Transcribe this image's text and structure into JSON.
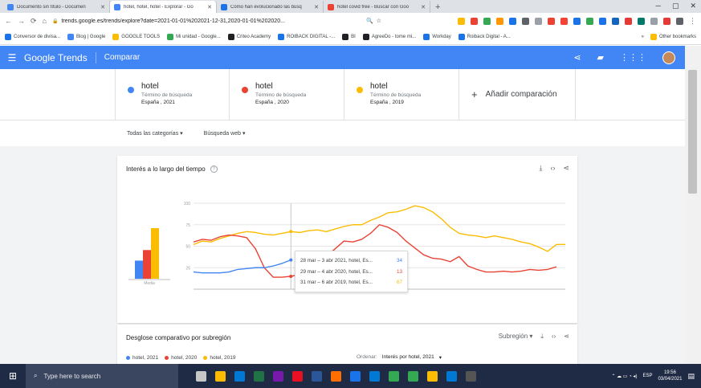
{
  "browser": {
    "tabs": [
      {
        "title": "Documento sin título - Documen",
        "color": "#4285f4"
      },
      {
        "title": "hotel, hotel, hotel - Explorar - Go",
        "color": "#4285f4",
        "active": true
      },
      {
        "title": "Cómo han evolucionado las búsq",
        "color": "#1a73e8"
      },
      {
        "title": "hotel covid free - Buscar con Goo",
        "color": "#ea4335"
      }
    ],
    "tab_close": "✕",
    "new_tab": "+",
    "window_controls": [
      "─",
      "▢",
      "✕"
    ],
    "address": "trends.google.es/trends/explore?date=2021-01-01%202021-12-31,2020-01-01%202020...",
    "bookmarks": [
      {
        "label": "Conversor de divisa...",
        "color": "#1a73e8"
      },
      {
        "label": "Blog | Google",
        "color": "#4285f4"
      },
      {
        "label": "GOOGLE TOOLS",
        "color": "#fbbc04"
      },
      {
        "label": "Mi unidad - Google...",
        "color": "#34a853"
      },
      {
        "label": "Criteo Academy",
        "color": "#202124"
      },
      {
        "label": "ROIBACK DIGITAL -...",
        "color": "#1a73e8"
      },
      {
        "label": "BI",
        "color": "#202124"
      },
      {
        "label": "AgreeDo - tome mi...",
        "color": "#202124"
      },
      {
        "label": "Workday",
        "color": "#1a73e8"
      },
      {
        "label": "Roiback Digital - A...",
        "color": "#1a73e8"
      }
    ],
    "bookmarks_more": "»",
    "other_bookmarks": "Other bookmarks"
  },
  "header": {
    "logo": "Google Trends",
    "section": "Comparar",
    "color": "#4285f4"
  },
  "terms": [
    {
      "name": "hotel",
      "type": "Término de búsqueda",
      "geo": "España , 2021",
      "color": "#4285f4"
    },
    {
      "name": "hotel",
      "type": "Término de búsqueda",
      "geo": "España , 2020",
      "color": "#ea4335"
    },
    {
      "name": "hotel",
      "type": "Término de búsqueda",
      "geo": "España , 2019",
      "color": "#fbbc04"
    }
  ],
  "add_comparison": "Añadir comparación",
  "filters": {
    "category": "Todas las categorías",
    "search_type": "Búsqueda web"
  },
  "interest_card": {
    "title": "Interés a lo largo del tiempo",
    "average_label": "Media",
    "tooltip": [
      {
        "label": "28 mar – 3 abr 2021, hotel, Es...",
        "value": "34",
        "color": "#4285f4"
      },
      {
        "label": "29 mar – 4 abr 2020, hotel, Es...",
        "value": "13",
        "color": "#ea4335"
      },
      {
        "label": "31 mar – 6 abr 2019, hotel, Es...",
        "value": "67",
        "color": "#fbbc04"
      }
    ]
  },
  "chart_data": {
    "type": "line",
    "title": "Interés a lo largo del tiempo",
    "xlabel": "",
    "ylabel": "",
    "ylim": [
      0,
      100
    ],
    "yticks": [
      25,
      50,
      75,
      100
    ],
    "series": [
      {
        "name": "hotel, 2021",
        "color": "#4285f4",
        "values": [
          20,
          19,
          19,
          19,
          20,
          23,
          24,
          25,
          25,
          27,
          30,
          34
        ]
      },
      {
        "name": "hotel, 2020",
        "color": "#ea4335",
        "values": [
          55,
          58,
          57,
          61,
          63,
          62,
          60,
          47,
          25,
          14,
          14,
          15,
          17,
          24,
          32,
          38,
          47,
          56,
          55,
          58,
          65,
          75,
          72,
          66,
          56,
          48,
          40,
          36,
          35,
          32,
          38,
          27,
          23,
          20,
          20,
          21,
          20,
          21,
          23,
          22,
          23,
          26
        ]
      },
      {
        "name": "hotel, 2019",
        "color": "#fbbc04",
        "values": [
          52,
          56,
          55,
          59,
          62,
          65,
          67,
          66,
          64,
          63,
          65,
          67,
          66,
          68,
          69,
          67,
          70,
          73,
          75,
          75,
          80,
          84,
          89,
          90,
          93,
          97,
          95,
          90,
          82,
          72,
          65,
          63,
          62,
          60,
          62,
          60,
          58,
          55,
          53,
          49,
          44,
          52,
          52
        ]
      }
    ],
    "averages": [
      {
        "name": "hotel, 2021",
        "value": 24,
        "color": "#4285f4"
      },
      {
        "name": "hotel, 2020",
        "value": 38,
        "color": "#ea4335"
      },
      {
        "name": "hotel, 2019",
        "value": 67,
        "color": "#fbbc04"
      }
    ]
  },
  "region_card": {
    "title": "Desglose comparativo por subregión",
    "view_label": "Subregión",
    "legend": [
      {
        "label": "hotel, 2021",
        "color": "#4285f4"
      },
      {
        "label": "hotel, 2020",
        "color": "#ea4335"
      },
      {
        "label": "hotel, 2019",
        "color": "#fbbc04"
      }
    ],
    "sort_label": "Ordenar:",
    "sort_value": "Interés por hotel, 2021"
  },
  "taskbar": {
    "search_placeholder": "Type here to search",
    "lang": "ESP",
    "time": "19:56",
    "date": "03/04/2021",
    "apps": [
      "#c7c7c7",
      "#fbbc04",
      "#0078d4",
      "#217346",
      "#7719aa",
      "#e81123",
      "#2b579a",
      "#ff6f00",
      "#1a73e8",
      "#0078d4",
      "#34a853",
      "#34a853",
      "#fbbc04",
      "#0078d4",
      "#555"
    ]
  }
}
